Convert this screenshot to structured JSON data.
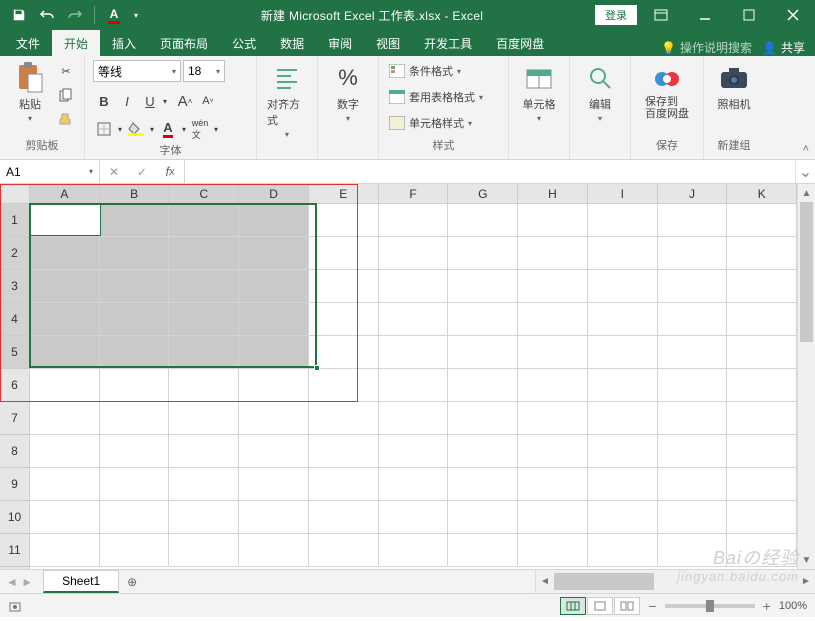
{
  "title": "新建 Microsoft Excel 工作表.xlsx  -  Excel",
  "login": "登录",
  "tabs": {
    "file": "文件",
    "home": "开始",
    "insert": "插入",
    "layout": "页面布局",
    "formulas": "公式",
    "data": "数据",
    "review": "审阅",
    "view": "视图",
    "dev": "开发工具",
    "baidu": "百度网盘"
  },
  "tellme": "操作说明搜索",
  "share": "共享",
  "ribbon": {
    "clipboard": {
      "label": "剪贴板",
      "paste": "粘贴"
    },
    "font": {
      "label": "字体",
      "name": "等线",
      "size": "18"
    },
    "alignment": {
      "label": "对齐方式"
    },
    "number": {
      "label": "数字"
    },
    "styles": {
      "label": "样式",
      "cond": "条件格式",
      "table": "套用表格格式",
      "cell": "单元格样式"
    },
    "cells": {
      "label": "单元格"
    },
    "editing": {
      "label": "编辑"
    },
    "save": {
      "label": "保存",
      "btn": "保存到\n百度网盘"
    },
    "camera": {
      "label": "新建组",
      "btn": "照相机"
    }
  },
  "namebox": "A1",
  "columns": [
    "A",
    "B",
    "C",
    "D",
    "E",
    "F",
    "G",
    "H",
    "I",
    "J",
    "K"
  ],
  "rows": [
    "1",
    "2",
    "3",
    "4",
    "5",
    "6",
    "7",
    "8",
    "9",
    "10",
    "11"
  ],
  "sheet_tab": "Sheet1",
  "zoom": "100%",
  "watermark": {
    "l1": "Baiの经验",
    "l2": "jingyan.baidu.com"
  }
}
